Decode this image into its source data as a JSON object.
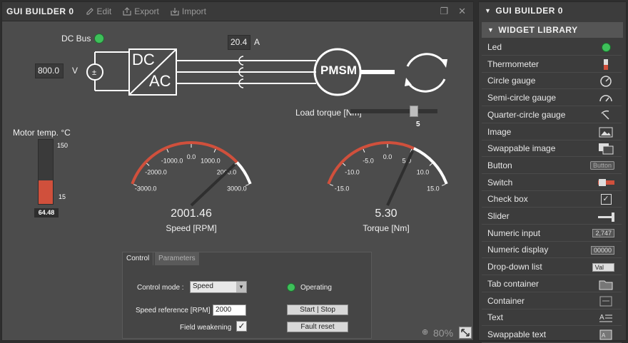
{
  "left_window": {
    "title": "GUI BUILDER 0",
    "toolbar": {
      "edit": "Edit",
      "export": "Export",
      "import": "Import"
    }
  },
  "dc_bus": {
    "label": "DC Bus",
    "voltage_value": "800.0",
    "voltage_unit": "V"
  },
  "converter": {
    "line1": "DC",
    "line2": "AC"
  },
  "current": {
    "value": "20.4",
    "unit": "A"
  },
  "motor": {
    "label": "PMSM"
  },
  "load_torque": {
    "label": "Load torque [Nm]",
    "value": "5",
    "fraction": 0.75
  },
  "thermometer": {
    "label": "Motor temp. °C",
    "max": "150",
    "min": "15",
    "value": "64.48",
    "fill_fraction": 0.37
  },
  "speed_gauge": {
    "value": "2001.46",
    "title": "Speed [RPM]",
    "min": -3000,
    "max": 3000,
    "reading": 2001.46,
    "ticks": [
      "-3000.0",
      "-2000.0",
      "-1000.0",
      "0.0",
      "1000.0",
      "2000.0",
      "3000.0"
    ]
  },
  "torque_gauge": {
    "value": "5.30",
    "title": "Torque [Nm]",
    "min": -15,
    "max": 15,
    "reading": 5.3,
    "ticks": [
      "-15.0",
      "-10.0",
      "-5.0",
      "0.0",
      "5.0",
      "10.0",
      "15.0"
    ]
  },
  "control": {
    "tabs": [
      "Control",
      "Parameters"
    ],
    "mode_label": "Control mode :",
    "mode_value": "Speed",
    "status_label": "Operating",
    "speed_ref_label": "Speed reference [RPM]",
    "speed_ref_value": "2000",
    "field_weakening_label": "Field weakening",
    "field_weakening_checked": "✓",
    "start_stop": "Start | Stop",
    "fault_reset": "Fault reset"
  },
  "zoom": {
    "value": "80%"
  },
  "right_panel": {
    "title": "GUI BUILDER 0",
    "section": "WIDGET LIBRARY",
    "items": [
      {
        "label": "Led",
        "icon": "led-icon"
      },
      {
        "label": "Thermometer",
        "icon": "thermometer-icon"
      },
      {
        "label": "Circle gauge",
        "icon": "circle-gauge-icon"
      },
      {
        "label": "Semi-circle gauge",
        "icon": "semi-circle-gauge-icon"
      },
      {
        "label": "Quarter-circle gauge",
        "icon": "quarter-circle-gauge-icon"
      },
      {
        "label": "Image",
        "icon": "image-icon"
      },
      {
        "label": "Swappable image",
        "icon": "swappable-image-icon"
      },
      {
        "label": "Button",
        "icon": "button-icon",
        "icon_text": "Button"
      },
      {
        "label": "Switch",
        "icon": "switch-icon"
      },
      {
        "label": "Check box",
        "icon": "checkbox-icon"
      },
      {
        "label": "Slider",
        "icon": "slider-icon"
      },
      {
        "label": "Numeric input",
        "icon": "numeric-input-icon",
        "icon_text": "2,747"
      },
      {
        "label": "Numeric display",
        "icon": "numeric-display-icon",
        "icon_text": "00000"
      },
      {
        "label": "Drop-down list",
        "icon": "dropdown-icon",
        "icon_text": "Val"
      },
      {
        "label": "Tab container",
        "icon": "tab-container-icon"
      },
      {
        "label": "Container",
        "icon": "container-icon"
      },
      {
        "label": "Text",
        "icon": "text-icon"
      },
      {
        "label": "Swappable text",
        "icon": "swappable-text-icon"
      }
    ]
  },
  "colors": {
    "accent_red": "#d0503c",
    "led_green": "#3ec05a",
    "needle": "#2f2f2f"
  }
}
